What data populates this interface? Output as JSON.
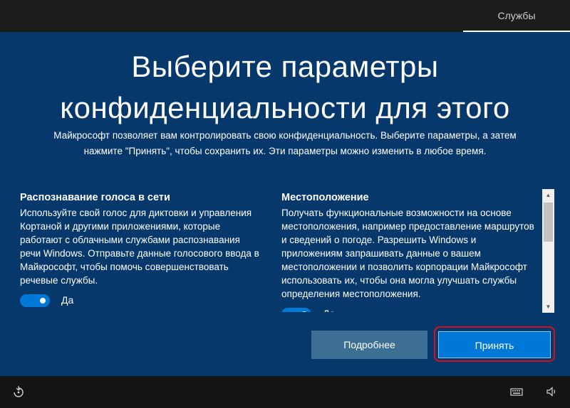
{
  "topbar": {
    "tab_label": "Службы"
  },
  "main": {
    "title_line1": "Выберите параметры",
    "title_line2": "конфиденциальности для этого",
    "subtitle_line1": "Майкрософт позволяет вам контролировать свою конфиденциальность. Выберите параметры, а затем",
    "subtitle_line2": "нажмите \"Принять\", чтобы сохранить их. Эти параметры можно изменить в любое время."
  },
  "settings": {
    "speech": {
      "title": "Распознавание голоса в сети",
      "description": "Используйте свой голос для диктовки и управления Кортаной и другими приложениями, которые работают с облачными службами распознавания речи Windows. Отправьте данные голосового ввода в Майкрософт, чтобы помочь совершенствовать речевые службы.",
      "toggle_label": "Да",
      "toggle_on": true
    },
    "location": {
      "title": "Местоположение",
      "description": "Получать функциональные возможности на основе местоположения, например предоставление маршрутов и сведений о погоде. Разрешить Windows и приложениям запрашивать данные о вашем местоположении и позволить корпорации Майкрософт использовать их, чтобы она могла улучшать службы определения местоположения.",
      "toggle_label": "Да",
      "toggle_on": true
    }
  },
  "buttons": {
    "more_label": "Подробнее",
    "accept_label": "Принять"
  },
  "bottombar": {
    "icons": [
      "accessibility-icon",
      "keyboard-icon",
      "volume-icon"
    ]
  },
  "colors": {
    "background": "#06386b",
    "accent": "#0078d7",
    "highlight_ring": "#d6101f"
  }
}
